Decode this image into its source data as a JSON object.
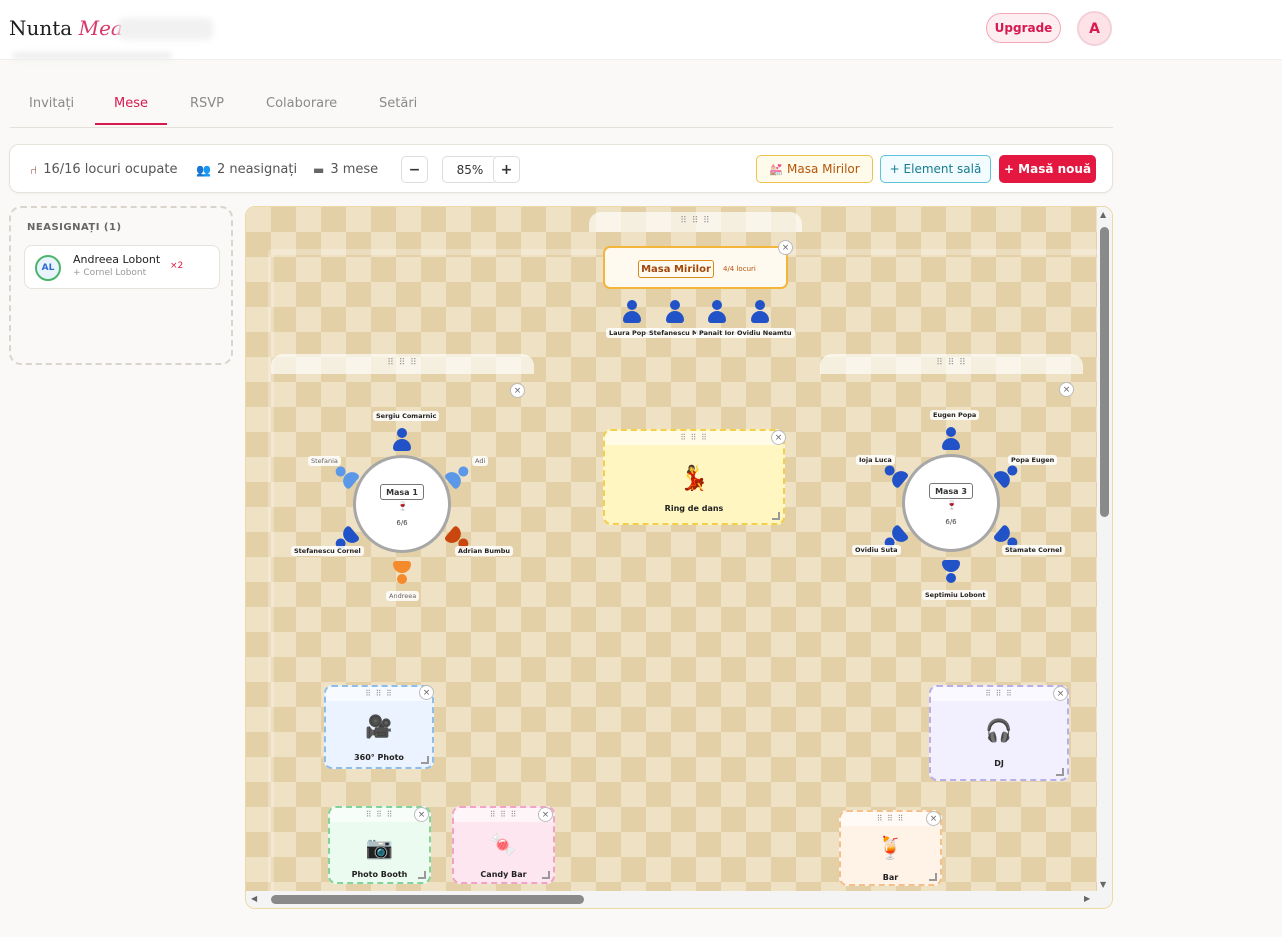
{
  "header": {
    "logo_main": "Nunta",
    "logo_accent": "Mea",
    "upgrade_label": "Upgrade",
    "avatar_initial": "A"
  },
  "tabs": [
    {
      "label": "Invitați",
      "active": false
    },
    {
      "label": "Mese",
      "active": true
    },
    {
      "label": "RSVP",
      "active": false
    },
    {
      "label": "Colaborare",
      "active": false
    },
    {
      "label": "Setări",
      "active": false
    }
  ],
  "toolbar": {
    "seats_text": "16/16 locuri ocupate",
    "unassigned_text": "2 neasignați",
    "tables_text": "3 mese",
    "zoom_out": "−",
    "zoom_value": "85%",
    "zoom_in": "+",
    "head_table_btn": "Masa Mirilor",
    "add_element_btn": "+ Element sală",
    "new_table_btn": "+ Masă nouă"
  },
  "unassigned": {
    "title": "NEASIGNAȚI (1)",
    "guests": [
      {
        "initials": "AL",
        "name": "Andreea Lobont",
        "sub": "+ Cornel Lobont",
        "multiplier": "×2"
      }
    ]
  },
  "canvas": {
    "handle_glyph": "⠿ ⠿ ⠿",
    "close_glyph": "×",
    "head_table": {
      "label": "Masa Mirilor",
      "count": "4/4 locuri",
      "guests": [
        "Laura Pope:",
        "Stefanescu Mar",
        "Panait Ionu",
        "Ovidiu Neamtu"
      ]
    },
    "tables": [
      {
        "label": "Masa 1",
        "count": "6/6",
        "guests": {
          "top": "Sergiu Comarnic",
          "upper_left": "Stefania",
          "upper_right": "Adi",
          "lower_left": "Stefanescu Cornel",
          "lower_right": "Adrian Bumbu",
          "bottom": "Andreea"
        }
      },
      {
        "label": "Masa 3",
        "count": "6/6",
        "guests": {
          "top": "Eugen Popa",
          "upper_left": "Ioja Luca",
          "upper_right": "Popa Eugen",
          "lower_left": "Ovidiu Suta",
          "lower_right": "Stamate Cornel",
          "bottom": "Septimiu Lobont"
        }
      }
    ],
    "elements": {
      "dance": {
        "name": "Ring de dans",
        "icon": "💃"
      },
      "photo360": {
        "name": "360° Photo",
        "icon": "🎥"
      },
      "dj": {
        "name": "DJ",
        "icon": "🎧"
      },
      "booth": {
        "name": "Photo Booth",
        "icon": "📷"
      },
      "candy": {
        "name": "Candy Bar",
        "icon": "🍬"
      },
      "bar": {
        "name": "Bar",
        "icon": "🍹"
      }
    }
  },
  "icons": {
    "seats": "chair-icon",
    "unassigned": "people-icon",
    "tables": "table-icon",
    "head_table": "couple-icon",
    "glass": "wine-glass-icon"
  },
  "colors": {
    "brand": "#d61a4f",
    "primary_button": "#e3173f",
    "guest_blue": "#2252c7",
    "head_table_border": "#f3b53a"
  }
}
